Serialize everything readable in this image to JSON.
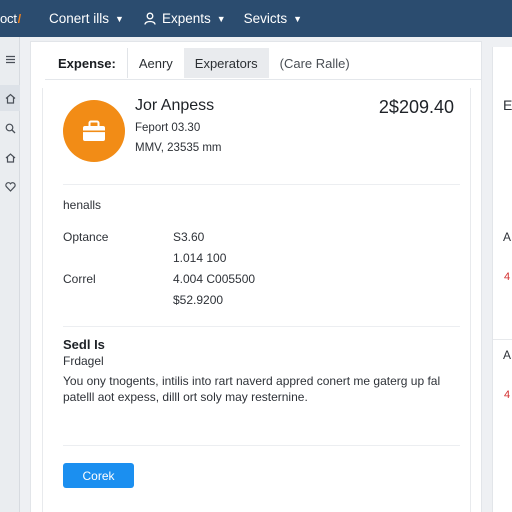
{
  "topbar": {
    "brand": "oct",
    "items": [
      {
        "label": "Conert ills",
        "has_icon": false
      },
      {
        "label": "Expents",
        "has_icon": true,
        "icon": "user-icon"
      },
      {
        "label": "Sevicts",
        "has_icon": false
      }
    ]
  },
  "rail": {
    "icons": [
      "menu-icon",
      "home-icon",
      "search-icon",
      "house-icon",
      "heart-icon"
    ]
  },
  "tabs": [
    {
      "label": "Expense:",
      "active": false
    },
    {
      "label": "Aenry",
      "active": false
    },
    {
      "label": "Experators",
      "active": true
    },
    {
      "label": "(Care Ralle)",
      "active": false
    }
  ],
  "expense": {
    "icon": "briefcase-icon",
    "accent_color": "#f28c16",
    "person": "Jor Anpess",
    "line1": "Feport 03.30",
    "line2": "MMV, 23535 mm",
    "amount": "2$209.40"
  },
  "totals": {
    "heading": "henalls",
    "rows": [
      {
        "label": "Optance",
        "value": "S3.60"
      },
      {
        "label": "",
        "value": "1.014 100"
      },
      {
        "label": "Correl",
        "value": "4.004 C005500"
      },
      {
        "label": "",
        "value": "$52.9200"
      }
    ]
  },
  "details": {
    "heading": "Sedl Is",
    "subheading": "Frdagel",
    "paragraph": "You ony tnogents, intilis into rart naverd appred conert me gaterg up fal patelll aot expess, dilll ort soly may resternine."
  },
  "action": {
    "label": "Corek",
    "color": "#1b8ff0"
  },
  "side_panel": {
    "title": "E",
    "items": [
      {
        "label": "A",
        "badge": "4"
      },
      {
        "label": "A",
        "badge": "4"
      }
    ]
  }
}
